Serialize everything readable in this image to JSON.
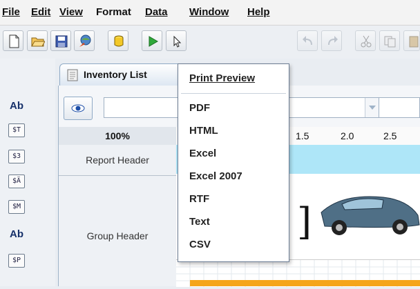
{
  "menubar": {
    "items": [
      {
        "label": "File",
        "mnemonic": "F"
      },
      {
        "label": "Edit",
        "mnemonic": "E"
      },
      {
        "label": "View",
        "mnemonic": "V"
      },
      {
        "label": "Format",
        "mnemonic": "o"
      },
      {
        "label": "Data",
        "mnemonic": "D"
      },
      {
        "label": "Window",
        "mnemonic": "W"
      },
      {
        "label": "Help",
        "mnemonic": "H"
      }
    ]
  },
  "toolbar": {
    "buttons": [
      "new-file-icon",
      "open-folder-icon",
      "save-icon",
      "publish-icon",
      "database-icon",
      "run-icon",
      "select-arrow-icon",
      "undo-icon",
      "redo-icon",
      "cut-icon",
      "copy-icon",
      "paste-icon"
    ]
  },
  "palette": {
    "items": [
      {
        "label": "Ab"
      },
      {
        "label": "$T"
      },
      {
        "label": "$3"
      },
      {
        "label": "$Ä"
      },
      {
        "label": "$M"
      },
      {
        "label": "Ab"
      },
      {
        "label": "$P"
      }
    ]
  },
  "document": {
    "tab_label": "Inventory List",
    "zoom": "100%",
    "ruler_labels": [
      "1.5",
      "2.0",
      "2.5"
    ],
    "sections": [
      {
        "label": "Report Header"
      },
      {
        "label": "Group Header"
      }
    ]
  },
  "dropdown": {
    "header": "Print Preview",
    "items": [
      {
        "label": "PDF"
      },
      {
        "label": "HTML"
      },
      {
        "label": "Excel"
      },
      {
        "label": "Excel 2007"
      },
      {
        "label": "RTF"
      },
      {
        "label": "Text"
      },
      {
        "label": "CSV"
      }
    ]
  },
  "colors": {
    "report_header_band": "#aee6f8",
    "footer_band": "#f5a51a",
    "run_icon": "#2fa83a",
    "car_body": "#4f6f86"
  }
}
